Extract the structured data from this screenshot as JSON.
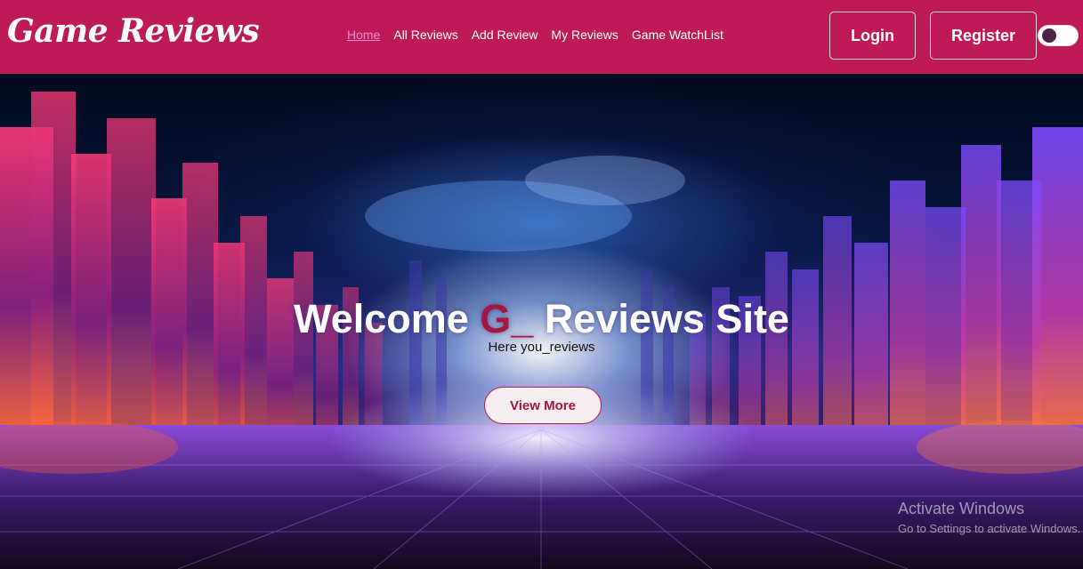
{
  "brand": {
    "name": "Game Reviews"
  },
  "nav": {
    "links": [
      {
        "label": "Home",
        "active": true
      },
      {
        "label": "All Reviews",
        "active": false
      },
      {
        "label": "Add Review",
        "active": false
      },
      {
        "label": "My Reviews",
        "active": false
      },
      {
        "label": "Game WatchList",
        "active": false
      }
    ],
    "login_label": "Login",
    "register_label": "Register",
    "theme_toggle_on": false
  },
  "hero": {
    "title_before": "Welcome ",
    "title_accent": "G_",
    "title_after": " Reviews Site",
    "subtitle": "Here you_reviews",
    "cta_label": "View More"
  },
  "watermark": {
    "title": "Activate Windows",
    "subtitle": "Go to Settings to activate Windows."
  },
  "colors": {
    "navbar_bg": "#be1a58",
    "nav_active": "#f28bd6",
    "accent": "#a3163e"
  }
}
